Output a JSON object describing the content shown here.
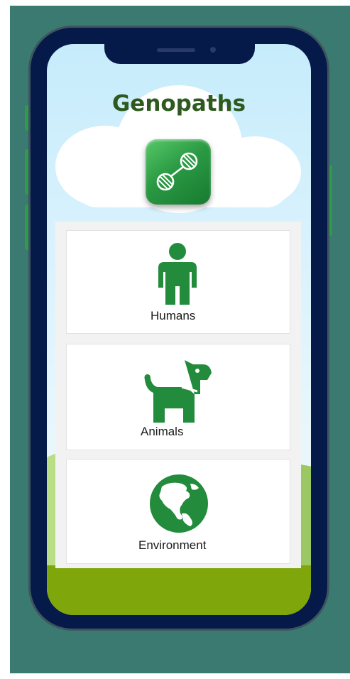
{
  "app": {
    "title": "Genopaths"
  },
  "logo": {
    "icon": "dna-icon",
    "color": "#2b9a44"
  },
  "categories": [
    {
      "label": "Humans",
      "icon": "person-icon"
    },
    {
      "label": "Animals",
      "icon": "dog-icon"
    },
    {
      "label": "Environment",
      "icon": "globe-icon"
    }
  ],
  "colors": {
    "accent": "#228b3c",
    "title": "#2e5a1f",
    "background": "#3a7a70",
    "ground": "#7fa60a"
  }
}
